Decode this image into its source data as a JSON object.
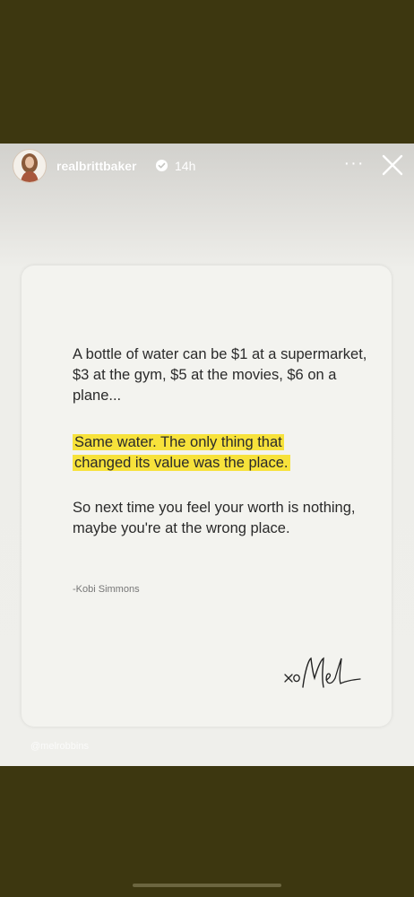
{
  "story": {
    "username": "realbrittbaker",
    "timestamp": "14h",
    "more_label": "···",
    "verified_icon": "verified-badge-icon",
    "close_icon": "close-icon"
  },
  "quote": {
    "paragraph1": "A bottle of water can be $1 at a supermarket, $3 at the gym, $5 at the movies, $6 on a plane...",
    "highlight_line1": "Same water. The only thing that",
    "highlight_line2": "changed its value was the place.",
    "paragraph3": "So next time you feel your worth is nothing, maybe you're at the wrong place.",
    "attribution": "-Kobi Simmons",
    "signature": "xo Mel",
    "highlight_color": "#f7e23b"
  },
  "watermark": "@melrobbins",
  "colors": {
    "background": "#3d3710",
    "card": "#f3f3ef"
  }
}
